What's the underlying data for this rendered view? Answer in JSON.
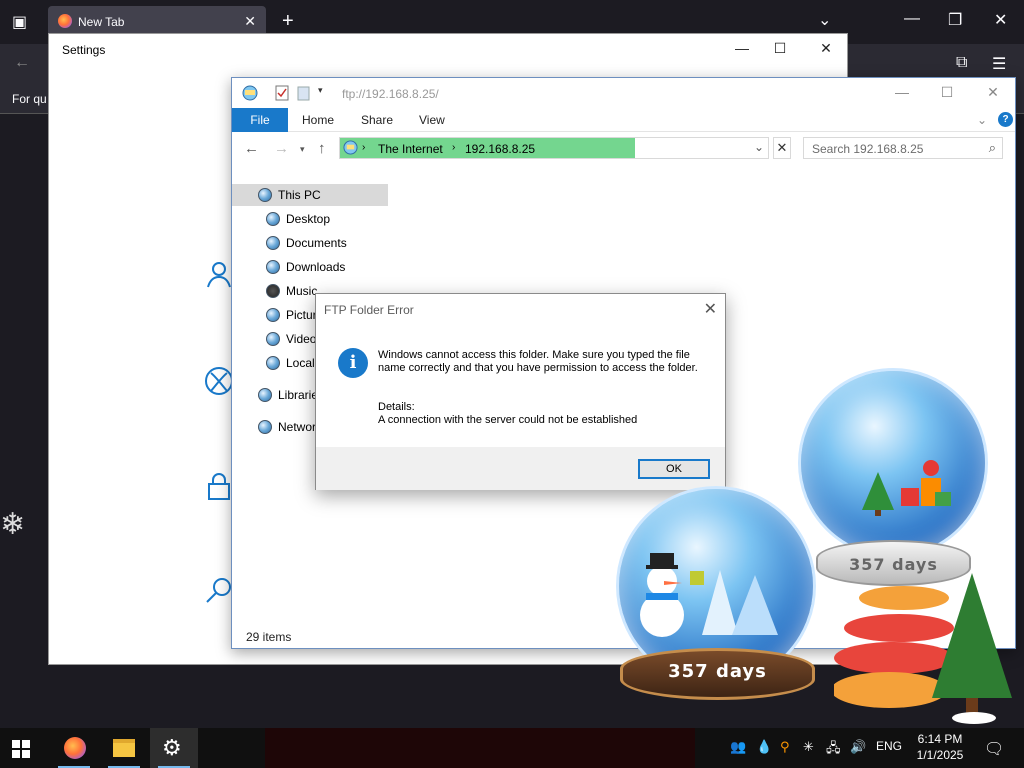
{
  "firefox": {
    "tab_title": "New Tab",
    "content_text": "For qu"
  },
  "settings": {
    "title": "Settings"
  },
  "explorer": {
    "title_path": "ftp://192.168.8.25/",
    "ribbon_tabs": [
      "File",
      "Home",
      "Share",
      "View"
    ],
    "address": {
      "crumbs": [
        "The Internet",
        "192.168.8.25"
      ]
    },
    "search_placeholder": "Search 192.168.8.25",
    "tree": [
      {
        "label": "This PC"
      },
      {
        "label": "Desktop"
      },
      {
        "label": "Documents"
      },
      {
        "label": "Downloads"
      },
      {
        "label": "Music"
      },
      {
        "label": "Pictur"
      },
      {
        "label": "Video"
      },
      {
        "label": "Local"
      },
      {
        "label": "Librarie"
      },
      {
        "label": "Networ"
      }
    ],
    "status": "29 items"
  },
  "dialog": {
    "title": "FTP Folder Error",
    "message": "Windows cannot access this folder. Make sure you typed the file name correctly and that you have permission to access the folder.",
    "details_label": "Details:",
    "details_text": "A connection with the server could not be established",
    "ok_label": "OK",
    "info_glyph": "i"
  },
  "widgets": {
    "globe_left_label": "357 days",
    "globe_right_label": "357 days"
  },
  "taskbar": {
    "language": "ENG",
    "time": "6:14 PM",
    "date": "1/1/2025"
  },
  "colors": {
    "accent": "#1979ca",
    "address_fill": "#74d68f"
  }
}
